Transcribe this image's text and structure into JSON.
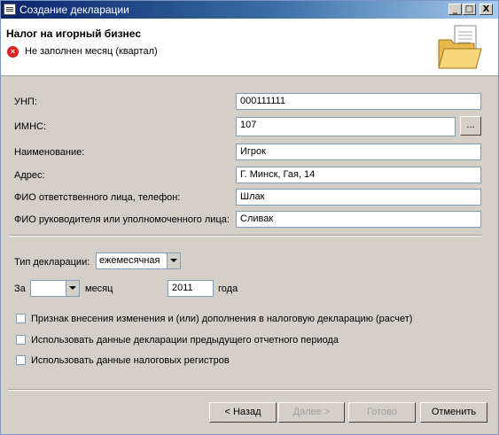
{
  "window": {
    "title": "Создание декларации"
  },
  "header": {
    "title": "Налог на игорный бизнес",
    "error": "Не заполнен месяц (квартал)"
  },
  "form": {
    "unp": {
      "label": "УНП:",
      "value": "000111111"
    },
    "imns": {
      "label": "ИМНС:",
      "value": "107",
      "browse_label": "..."
    },
    "name": {
      "label": "Наименование:",
      "value": "Игрок"
    },
    "address": {
      "label": "Адрес:",
      "value": "Г. Минск, Гая, 14"
    },
    "responsible": {
      "label": "ФИО ответственного лица, телефон:",
      "value": "Шлак"
    },
    "director": {
      "label": "ФИО руководителя или уполномоченного лица:",
      "value": "Сливак"
    }
  },
  "period": {
    "decl_type_label": "Тип декларации:",
    "decl_type_value": "ежемесячная",
    "for_label": "За",
    "month_value": "",
    "month_label": "месяц",
    "year_value": "2011",
    "year_label": "года"
  },
  "checkboxes": [
    {
      "label": "Признак внесения изменения и (или) дополнения в налоговую декларацию (расчет)",
      "checked": false
    },
    {
      "label": "Использовать данные декларации предыдущего отчетного периода",
      "checked": false
    },
    {
      "label": "Использовать данные налоговых регистров",
      "checked": false
    }
  ],
  "buttons": {
    "back": "< Назад",
    "next": "Далее >",
    "finish": "Готово",
    "cancel": "Отменить"
  },
  "titlebar_buttons": {
    "minimize": "_",
    "maximize": "□",
    "close": "X"
  }
}
